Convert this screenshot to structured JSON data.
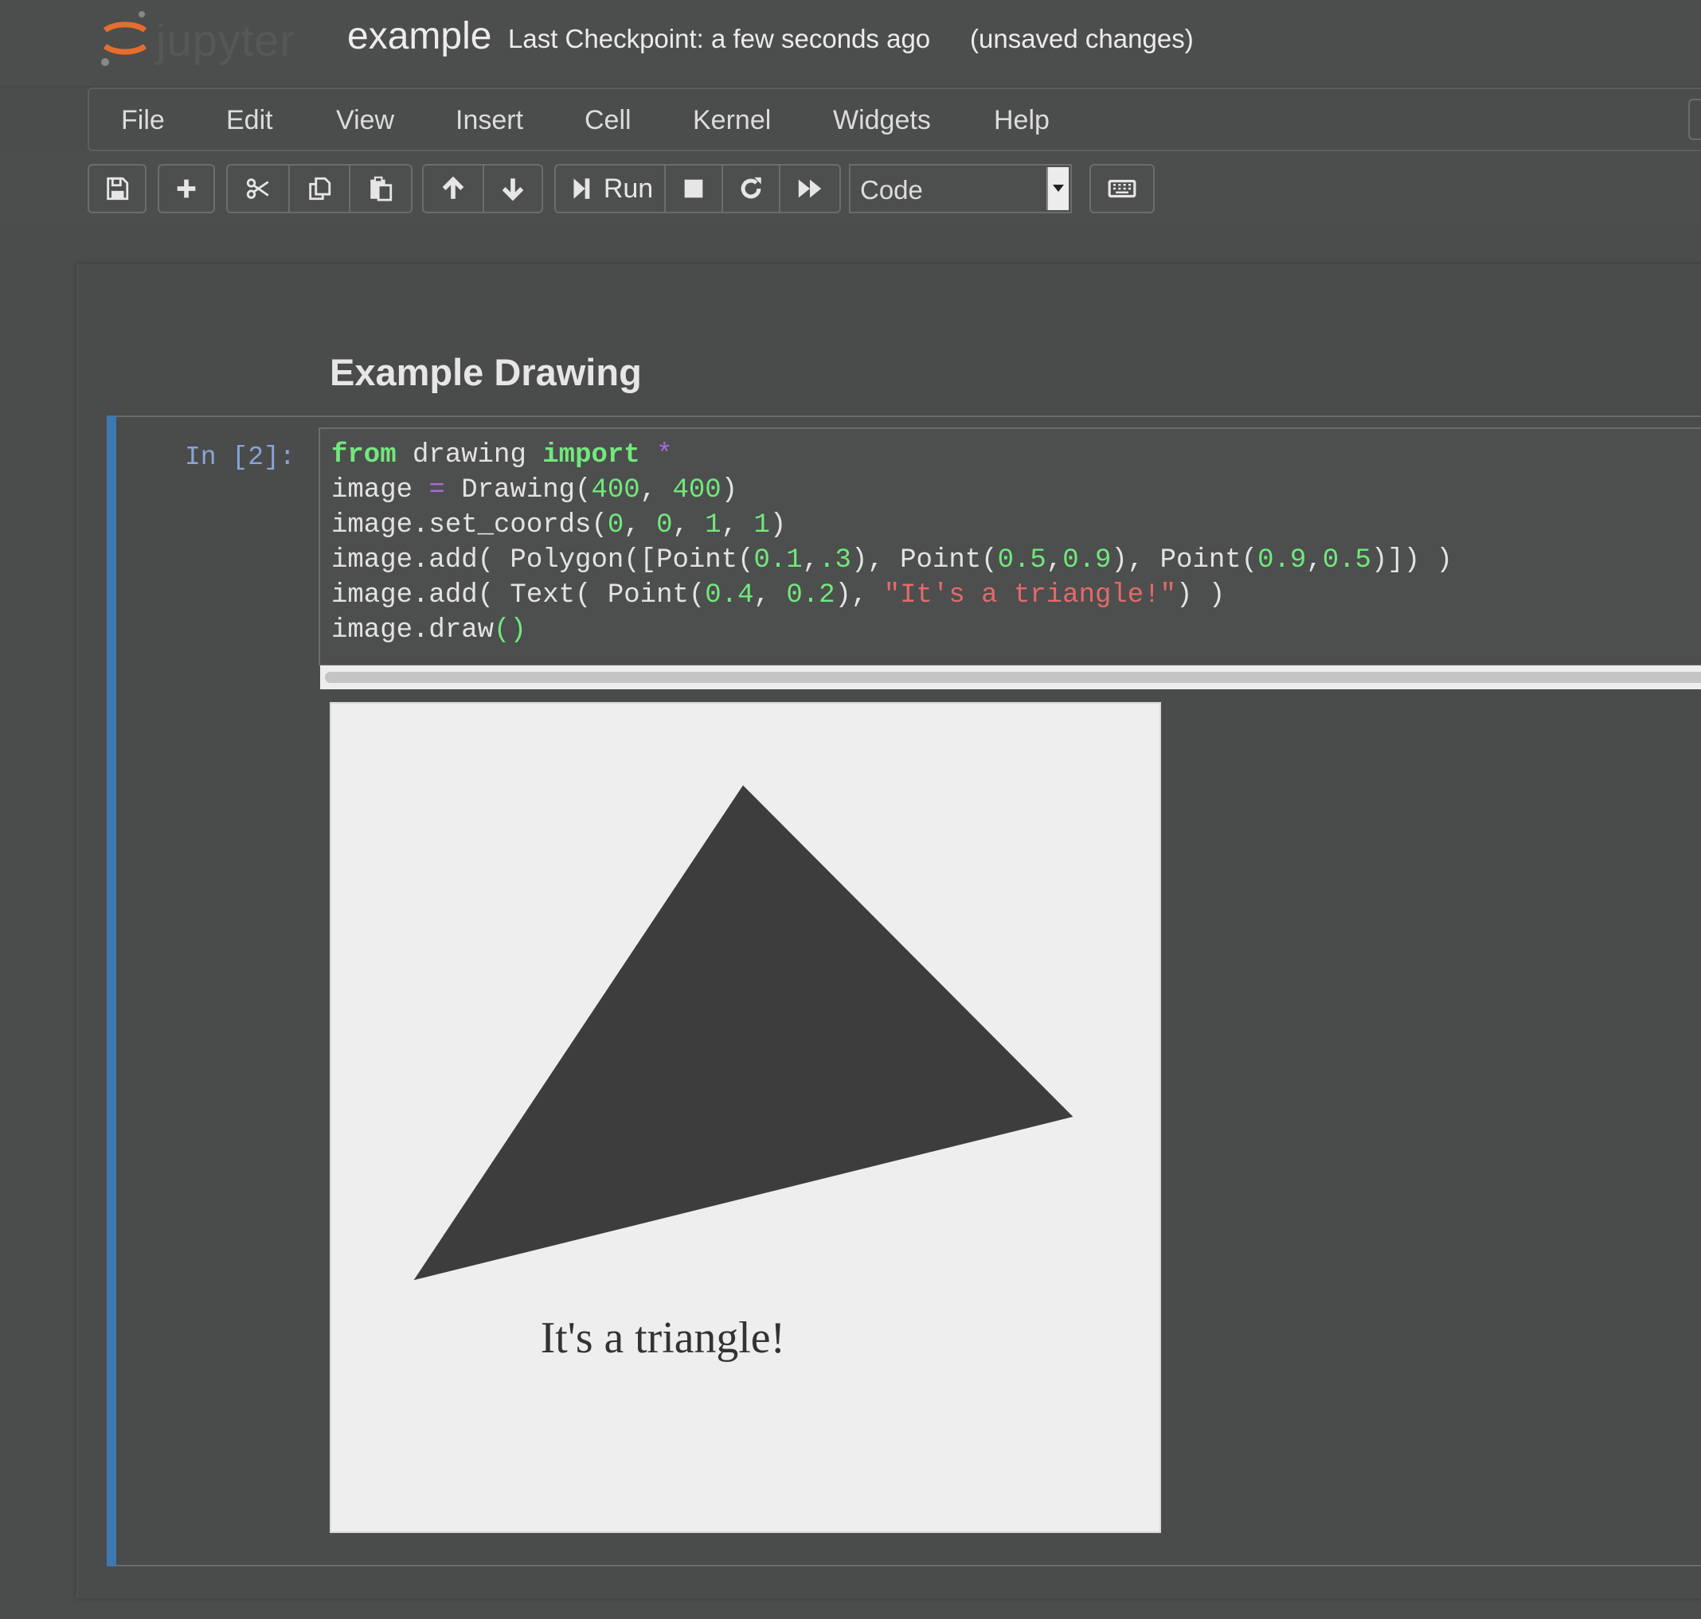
{
  "header": {
    "logo_text": "jupyter",
    "notebook_name": "example",
    "checkpoint": "Last Checkpoint: a few seconds ago",
    "status": "(unsaved changes)"
  },
  "menubar": {
    "items": [
      "File",
      "Edit",
      "View",
      "Insert",
      "Cell",
      "Kernel",
      "Widgets",
      "Help"
    ]
  },
  "toolbar": {
    "run_label": "Run",
    "cell_type": "Code",
    "icons": [
      "save-icon",
      "plus-icon",
      "scissors-icon",
      "copy-icon",
      "paste-icon",
      "arrow-up-icon",
      "arrow-down-icon",
      "step-forward-icon",
      "stop-icon",
      "restart-icon",
      "fast-forward-icon",
      "keyboard-icon"
    ]
  },
  "notebook": {
    "markdown_heading": "Example Drawing",
    "cell": {
      "prompt": "In [2]:",
      "code": {
        "l1_kw1": "from",
        "l1_mod": " drawing ",
        "l1_kw2": "import",
        "l1_star": " *",
        "l2_a": "image ",
        "l2_eq": "=",
        "l2_b": " Drawing(",
        "l2_n1": "400",
        "l2_c": ", ",
        "l2_n2": "400",
        "l2_d": ")",
        "l3_a": "image.set_coords(",
        "l3_n1": "0",
        "l3_n2": "0",
        "l3_n3": "1",
        "l3_n4": "1",
        "l4_a": "image.add( Polygon([Point(",
        "l4_n1": "0.1",
        "l4_n2": ".3",
        "l4_b": "), Point(",
        "l4_n3": "0.5",
        "l4_n4": "0.9",
        "l4_c": "), Point(",
        "l4_n5": "0.9",
        "l4_n6": "0.5",
        "l4_d": ")]) )",
        "l5_a": "image.add( Text( Point(",
        "l5_n1": "0.4",
        "l5_n2": "0.2",
        "l5_b": "), ",
        "l5_str": "\"It's a triangle!\"",
        "l5_c": ") )",
        "l6_a": "image.draw",
        "l6_p": "()"
      },
      "output": {
        "text": "It's a triangle!",
        "fill_color": "#3d3d3d",
        "background_color": "#eeeeee"
      }
    }
  },
  "colors": {
    "accent": "#3f77b3",
    "keyword": "#72e87c",
    "string": "#e36a6a",
    "operator": "#a86ad8",
    "prompt": "#8aa5d6"
  }
}
